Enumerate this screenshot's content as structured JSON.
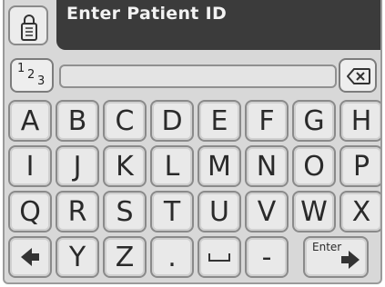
{
  "header": {
    "title": "Enter Patient ID"
  },
  "input": {
    "value": ""
  },
  "mode_button": {
    "digits": [
      "1",
      "2",
      "3"
    ]
  },
  "keyboard": {
    "row1": [
      "A",
      "B",
      "C",
      "D",
      "E",
      "F",
      "G",
      "H"
    ],
    "row2": [
      "I",
      "J",
      "K",
      "L",
      "M",
      "N",
      "O",
      "P"
    ],
    "row3": [
      "Q",
      "R",
      "S",
      "T",
      "U",
      "V",
      "W",
      "X"
    ],
    "row4": [
      "Y",
      "Z",
      ".",
      "-"
    ],
    "enter_label": "Enter"
  },
  "icons": [
    "lock-icon",
    "backspace-icon",
    "left-arrow-icon",
    "space-icon",
    "right-arrow-icon"
  ]
}
